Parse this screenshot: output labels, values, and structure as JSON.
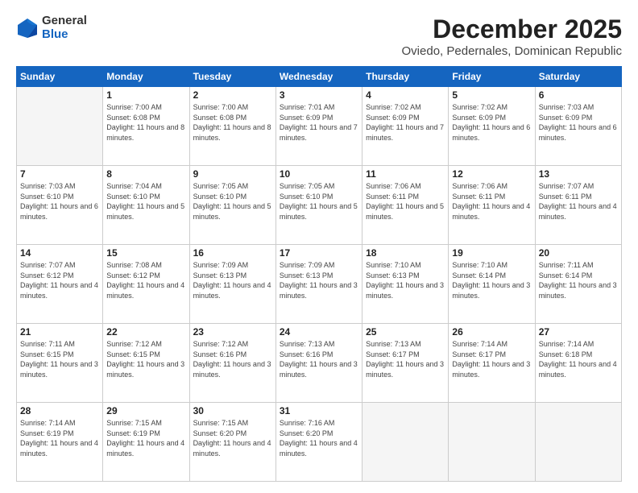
{
  "header": {
    "logo": {
      "line1": "General",
      "line2": "Blue"
    },
    "title": "December 2025",
    "subtitle": "Oviedo, Pedernales, Dominican Republic"
  },
  "weekdays": [
    "Sunday",
    "Monday",
    "Tuesday",
    "Wednesday",
    "Thursday",
    "Friday",
    "Saturday"
  ],
  "weeks": [
    [
      {
        "day": "",
        "empty": true
      },
      {
        "day": "1",
        "sunrise": "7:00 AM",
        "sunset": "6:08 PM",
        "daylight": "11 hours and 8 minutes."
      },
      {
        "day": "2",
        "sunrise": "7:00 AM",
        "sunset": "6:08 PM",
        "daylight": "11 hours and 8 minutes."
      },
      {
        "day": "3",
        "sunrise": "7:01 AM",
        "sunset": "6:09 PM",
        "daylight": "11 hours and 7 minutes."
      },
      {
        "day": "4",
        "sunrise": "7:02 AM",
        "sunset": "6:09 PM",
        "daylight": "11 hours and 7 minutes."
      },
      {
        "day": "5",
        "sunrise": "7:02 AM",
        "sunset": "6:09 PM",
        "daylight": "11 hours and 6 minutes."
      },
      {
        "day": "6",
        "sunrise": "7:03 AM",
        "sunset": "6:09 PM",
        "daylight": "11 hours and 6 minutes."
      }
    ],
    [
      {
        "day": "7",
        "sunrise": "7:03 AM",
        "sunset": "6:10 PM",
        "daylight": "11 hours and 6 minutes."
      },
      {
        "day": "8",
        "sunrise": "7:04 AM",
        "sunset": "6:10 PM",
        "daylight": "11 hours and 5 minutes."
      },
      {
        "day": "9",
        "sunrise": "7:05 AM",
        "sunset": "6:10 PM",
        "daylight": "11 hours and 5 minutes."
      },
      {
        "day": "10",
        "sunrise": "7:05 AM",
        "sunset": "6:10 PM",
        "daylight": "11 hours and 5 minutes."
      },
      {
        "day": "11",
        "sunrise": "7:06 AM",
        "sunset": "6:11 PM",
        "daylight": "11 hours and 5 minutes."
      },
      {
        "day": "12",
        "sunrise": "7:06 AM",
        "sunset": "6:11 PM",
        "daylight": "11 hours and 4 minutes."
      },
      {
        "day": "13",
        "sunrise": "7:07 AM",
        "sunset": "6:11 PM",
        "daylight": "11 hours and 4 minutes."
      }
    ],
    [
      {
        "day": "14",
        "sunrise": "7:07 AM",
        "sunset": "6:12 PM",
        "daylight": "11 hours and 4 minutes."
      },
      {
        "day": "15",
        "sunrise": "7:08 AM",
        "sunset": "6:12 PM",
        "daylight": "11 hours and 4 minutes."
      },
      {
        "day": "16",
        "sunrise": "7:09 AM",
        "sunset": "6:13 PM",
        "daylight": "11 hours and 4 minutes."
      },
      {
        "day": "17",
        "sunrise": "7:09 AM",
        "sunset": "6:13 PM",
        "daylight": "11 hours and 3 minutes."
      },
      {
        "day": "18",
        "sunrise": "7:10 AM",
        "sunset": "6:13 PM",
        "daylight": "11 hours and 3 minutes."
      },
      {
        "day": "19",
        "sunrise": "7:10 AM",
        "sunset": "6:14 PM",
        "daylight": "11 hours and 3 minutes."
      },
      {
        "day": "20",
        "sunrise": "7:11 AM",
        "sunset": "6:14 PM",
        "daylight": "11 hours and 3 minutes."
      }
    ],
    [
      {
        "day": "21",
        "sunrise": "7:11 AM",
        "sunset": "6:15 PM",
        "daylight": "11 hours and 3 minutes."
      },
      {
        "day": "22",
        "sunrise": "7:12 AM",
        "sunset": "6:15 PM",
        "daylight": "11 hours and 3 minutes."
      },
      {
        "day": "23",
        "sunrise": "7:12 AM",
        "sunset": "6:16 PM",
        "daylight": "11 hours and 3 minutes."
      },
      {
        "day": "24",
        "sunrise": "7:13 AM",
        "sunset": "6:16 PM",
        "daylight": "11 hours and 3 minutes."
      },
      {
        "day": "25",
        "sunrise": "7:13 AM",
        "sunset": "6:17 PM",
        "daylight": "11 hours and 3 minutes."
      },
      {
        "day": "26",
        "sunrise": "7:14 AM",
        "sunset": "6:17 PM",
        "daylight": "11 hours and 3 minutes."
      },
      {
        "day": "27",
        "sunrise": "7:14 AM",
        "sunset": "6:18 PM",
        "daylight": "11 hours and 4 minutes."
      }
    ],
    [
      {
        "day": "28",
        "sunrise": "7:14 AM",
        "sunset": "6:19 PM",
        "daylight": "11 hours and 4 minutes."
      },
      {
        "day": "29",
        "sunrise": "7:15 AM",
        "sunset": "6:19 PM",
        "daylight": "11 hours and 4 minutes."
      },
      {
        "day": "30",
        "sunrise": "7:15 AM",
        "sunset": "6:20 PM",
        "daylight": "11 hours and 4 minutes."
      },
      {
        "day": "31",
        "sunrise": "7:16 AM",
        "sunset": "6:20 PM",
        "daylight": "11 hours and 4 minutes."
      },
      {
        "day": "",
        "empty": true
      },
      {
        "day": "",
        "empty": true
      },
      {
        "day": "",
        "empty": true
      }
    ]
  ]
}
